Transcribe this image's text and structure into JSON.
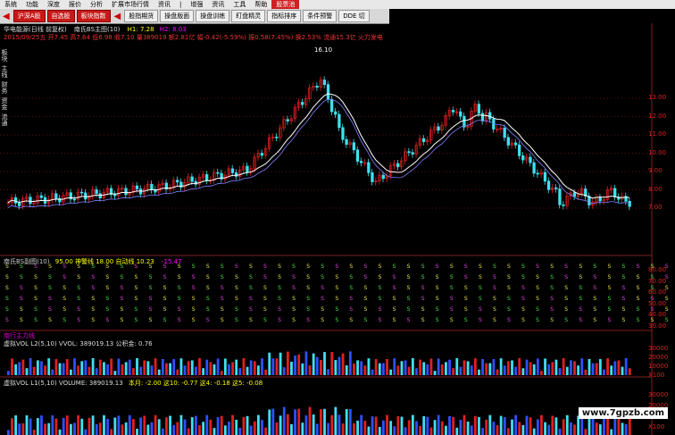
{
  "menu": {
    "items": [
      "系统",
      "功能",
      "深度",
      "报价",
      "分析",
      "扩展市场行情",
      "资讯",
      "|",
      "增强",
      "资讯",
      "工具",
      "帮助"
    ],
    "highlight": "股票池"
  },
  "toolbar": {
    "buttons": [
      "沪深A股",
      "自选股",
      "板块指数",
      "股指期货",
      "操盘版面",
      "操盘训练",
      "盯盘精灵",
      "指标排序",
      "条件预警",
      "DDE 切"
    ],
    "red_buttons": [
      "沪深A股",
      "自选股",
      "板块指数"
    ]
  },
  "header": {
    "stock": "华电能源(日线 前复权)",
    "indicator": "南氏BS主图(10)",
    "h1": "H1: 7.28",
    "h2": "H2: 8.03",
    "date_line": "2015/09/25五 开7.45 高7.64 低6.98 收7.10 量389019 额2.81亿 幅-0.42(-5.59%) 振0.58(7.45%) 换2.53% 流通15.3亿 火力发电",
    "peak": "16.10"
  },
  "price_axis": [
    "13.00",
    "12.00",
    "11.00",
    "10.00",
    "9.00",
    "8.00",
    "7.00"
  ],
  "sub1": {
    "title": "南氏BS副图(10)",
    "params": "95.00 神警线 18.00 自动线 10.23",
    "value": "-15.47",
    "axis": [
      "80.00",
      "70.00",
      "60.00",
      "50.00",
      "40.00",
      "30.00"
    ]
  },
  "sub2": {
    "label": "南行主力线",
    "title": "虚拟VOL L2(5,10) VVOL: 389019.13 公积金: 0.76",
    "axis": [
      "30000",
      "20000",
      "10000",
      "X100"
    ]
  },
  "sub3": {
    "title": "虚拟VOL L1(5,10) VOLUME: 389019.13",
    "extra": "本月: -2.00  这10: -0.77  这4: -0.18  这5: -0.08",
    "axis": [
      "30000",
      "20000",
      "10000",
      "X100"
    ]
  },
  "left_labels": [
    "板块",
    "主线",
    "财务",
    "资金",
    "流通"
  ],
  "watermark": "www.7gpzb.com",
  "colors": {
    "up": "#e02020",
    "down": "#40e0f0",
    "ma": "#ffffff",
    "purple": "#8080ff"
  }
}
